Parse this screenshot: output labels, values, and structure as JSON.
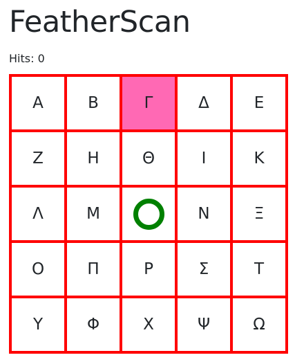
{
  "app": {
    "title": "FeatherScan",
    "hits_label": "Hits: 0"
  },
  "grid": {
    "cells": [
      {
        "letter": "Α"
      },
      {
        "letter": "Β"
      },
      {
        "letter": "Γ",
        "highlighted": true
      },
      {
        "letter": "Δ"
      },
      {
        "letter": "Ε"
      },
      {
        "letter": "Ζ"
      },
      {
        "letter": "Η"
      },
      {
        "letter": "Θ"
      },
      {
        "letter": "Ι"
      },
      {
        "letter": "Κ"
      },
      {
        "letter": "Λ"
      },
      {
        "letter": "Μ"
      },
      {
        "letter": "",
        "marker": "green-ring"
      },
      {
        "letter": "Ν"
      },
      {
        "letter": "Ξ"
      },
      {
        "letter": "Ο"
      },
      {
        "letter": "Π"
      },
      {
        "letter": "Ρ"
      },
      {
        "letter": "Σ"
      },
      {
        "letter": "Τ"
      },
      {
        "letter": "Υ"
      },
      {
        "letter": "Φ"
      },
      {
        "letter": "Χ"
      },
      {
        "letter": "Ψ"
      },
      {
        "letter": "Ω"
      }
    ]
  },
  "colors": {
    "grid_border": "#ff0000",
    "highlight": "#ff69b4",
    "marker": "#008000"
  }
}
